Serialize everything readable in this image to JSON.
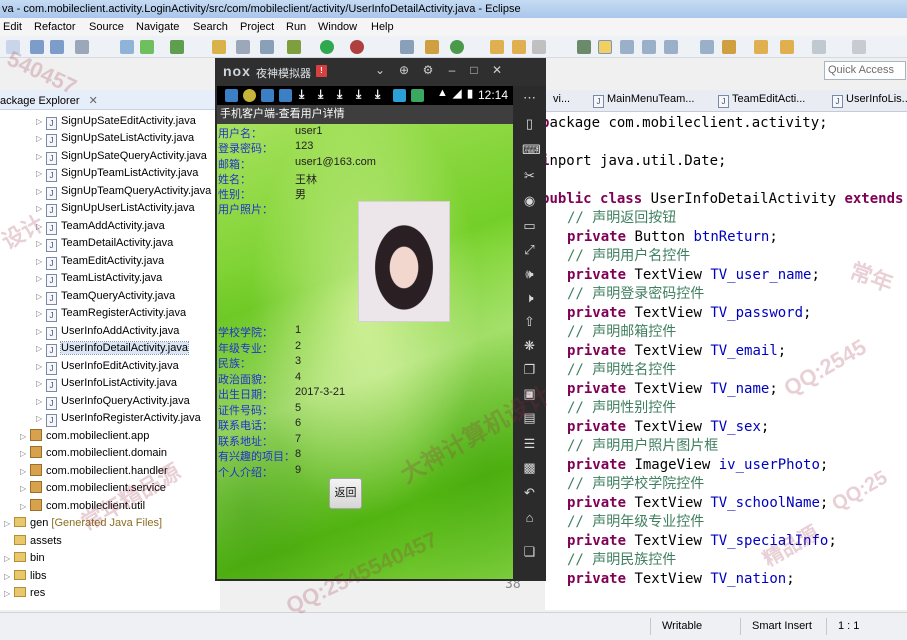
{
  "window": {
    "title": "va - com.mobileclient.activity.LoginActivity/src/com/mobileclient/activity/UserInfoDetailActivity.java - Eclipse"
  },
  "menu": [
    "Edit",
    "Refactor",
    "Source",
    "Navigate",
    "Search",
    "Project",
    "Run",
    "Window",
    "Help"
  ],
  "quick_access": "Quick Access",
  "package_explorer": {
    "title": "ackage Explorer",
    "files": [
      "SignUpSateEditActivity.java",
      "SignUpSateListActivity.java",
      "SignUpSateQueryActivity.java",
      "SignUpTeamListActivity.java",
      "SignUpTeamQueryActivity.java",
      "SignUpUserListActivity.java",
      "TeamAddActivity.java",
      "TeamDetailActivity.java",
      "TeamEditActivity.java",
      "TeamListActivity.java",
      "TeamQueryActivity.java",
      "TeamRegisterActivity.java",
      "UserInfoAddActivity.java",
      "UserInfoDetailActivity.java",
      "UserInfoEditActivity.java",
      "UserInfoListActivity.java",
      "UserInfoQueryActivity.java",
      "UserInfoRegisterActivity.java"
    ],
    "packages": [
      "com.mobileclient.app",
      "com.mobileclient.domain",
      "com.mobileclient.handler",
      "com.mobileclient.service",
      "com.mobileclient.util"
    ],
    "gen_label": "gen",
    "gen_note": "[Generated Java Files]",
    "folders": [
      "assets",
      "bin",
      "libs",
      "res"
    ]
  },
  "editor_tabs": [
    "vi...",
    "MainMenuTeam...",
    "TeamEditActi...",
    "UserInfoLis..."
  ],
  "code": {
    "l1": "ackage com.mobileclient.activity;",
    "l2": "nport java.util.Date;",
    "l3a": "ublic class",
    "l3b": " UserInfoDetailActivity ",
    "l3c": "extends",
    "c1": "// 声明返回按钮",
    "f1": "btnReturn",
    "t1": "Button",
    "c2": "// 声明用户名控件",
    "f2": "TV_user_name",
    "c3": "// 声明登录密码控件",
    "f3": "TV_password",
    "c4": "// 声明邮箱控件",
    "f4": "TV_email",
    "c5": "// 声明姓名控件",
    "f5": "TV_name",
    "c6": "// 声明性别控件",
    "f6": "TV_sex",
    "c7": "// 声明用户照片图片框",
    "t7": "ImageView",
    "f7": "iv_userPhoto",
    "c8": "// 声明学校学院控件",
    "f8": "TV_schoolName",
    "c9": "// 声明年级专业控件",
    "f9": "TV_specialInfo",
    "c10": "// 声明民族控件",
    "f10": "TV_nation",
    "private": "private",
    "textview": "TextView",
    "line_number": "38"
  },
  "status_bar": {
    "mode": "Writable",
    "insert": "Smart Insert",
    "position": "1 : 1"
  },
  "emulator": {
    "logo": "nox",
    "name": "夜神模拟器",
    "badge": "!",
    "time": "12:14",
    "app_title": "手机客户端-查看用户详情",
    "fields_top": [
      {
        "label": "用户名：",
        "value": "user1"
      },
      {
        "label": "登录密码：",
        "value": "123"
      },
      {
        "label": "邮箱：",
        "value": "user1@163.com"
      },
      {
        "label": "姓名：",
        "value": "王林"
      },
      {
        "label": "性别：",
        "value": "男"
      },
      {
        "label": "用户照片：",
        "value": ""
      }
    ],
    "fields_bottom": [
      {
        "label": "学校学院：",
        "value": "1"
      },
      {
        "label": "年级专业：",
        "value": "2"
      },
      {
        "label": "民族：",
        "value": "3"
      },
      {
        "label": "政治面貌：",
        "value": "4"
      },
      {
        "label": "出生日期：",
        "value": "2017-3-21"
      },
      {
        "label": "证件号码：",
        "value": "5"
      },
      {
        "label": "联系电话：",
        "value": "6"
      },
      {
        "label": "联系地址：",
        "value": "7"
      },
      {
        "label": "有兴趣的项目：",
        "value": "8"
      },
      {
        "label": "个人介绍：",
        "value": "9"
      }
    ],
    "back_button": "返回"
  },
  "watermarks": [
    "大神计算机设计",
    "QQ:2545",
    "常年精品源",
    "常年",
    "QQ:2545540457",
    "精品源",
    "设计",
    "540457",
    "QQ:25"
  ],
  "colors": {
    "keyword": "#7f0055",
    "comment": "#3f7f5f",
    "field": "#0000c0",
    "label_blue": "#2233cc"
  }
}
